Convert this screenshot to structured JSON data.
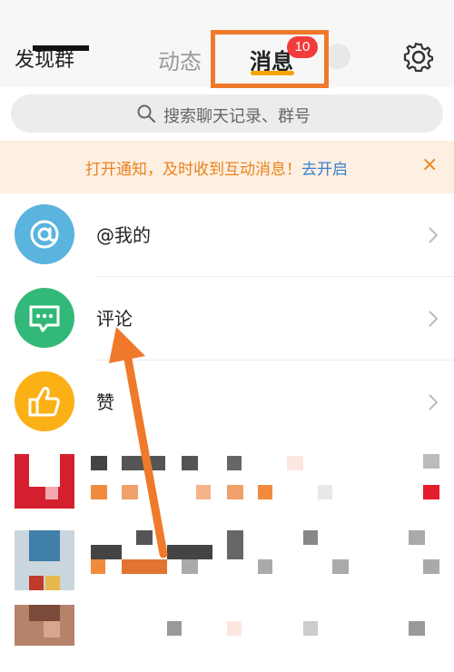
{
  "header": {
    "left_title": "发现群",
    "tabs": [
      {
        "label": "动态"
      },
      {
        "label": "消息",
        "badge": "10",
        "active": true
      }
    ],
    "settings_icon": "gear-icon"
  },
  "search": {
    "placeholder": "搜索聊天记录、群号",
    "icon": "search-icon"
  },
  "notice": {
    "text": "打开通知，及时收到互动消息！",
    "link": "去开启",
    "close": "×"
  },
  "items": [
    {
      "label": "@我的",
      "icon": "at-icon",
      "color": "#5ab4dd"
    },
    {
      "label": "评论",
      "icon": "comment-icon",
      "color": "#32b878"
    },
    {
      "label": "赞",
      "icon": "thumbs-up-icon",
      "color": "#fbb016"
    }
  ],
  "colors": {
    "accent_orange": "#f0792b",
    "badge_red": "#f23b3b",
    "tab_underline": "#f8a400"
  }
}
